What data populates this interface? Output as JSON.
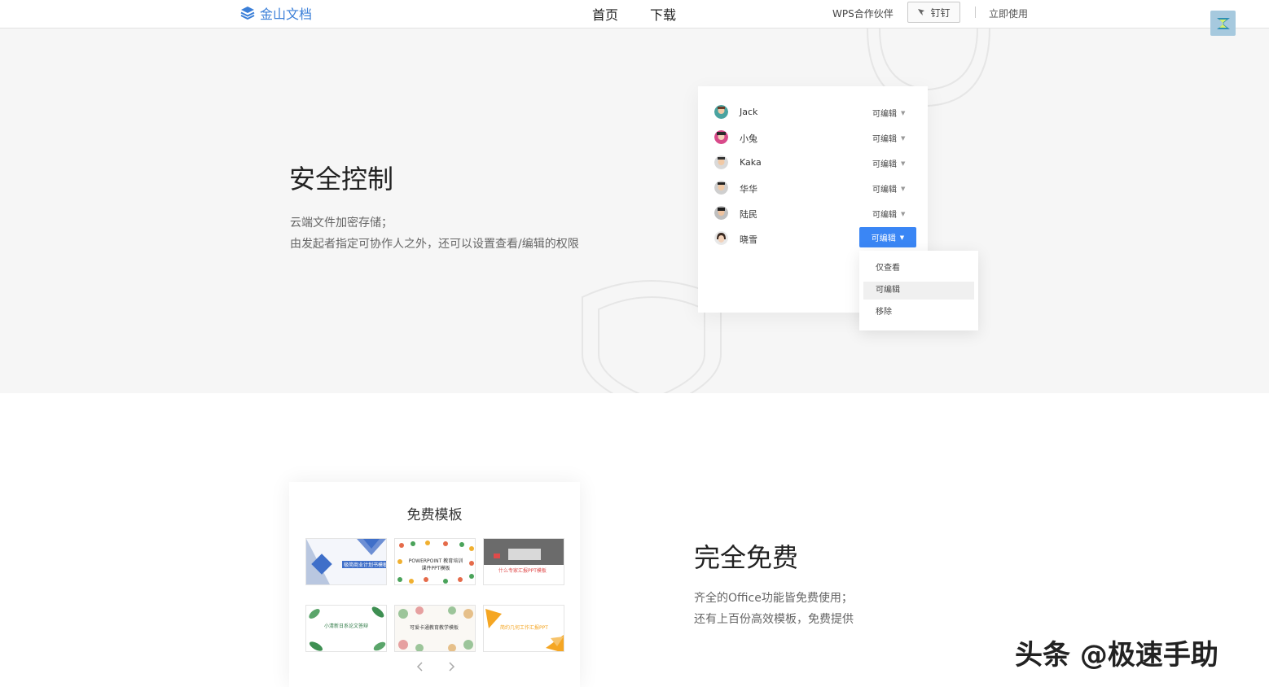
{
  "header": {
    "logo_text": "金山文档",
    "nav": [
      "首页",
      "下载"
    ],
    "partner": "WPS合作伙伴",
    "dingding": "钉钉",
    "use_now": "立即使用"
  },
  "security": {
    "title": "安全控制",
    "desc_lines": [
      "云端文件加密存储；",
      "由发起者指定可协作人之外，还可以设置查看/编辑的权限"
    ],
    "members": [
      {
        "name": "Jack",
        "permission": "可编辑"
      },
      {
        "name": "小兔",
        "permission": "可编辑"
      },
      {
        "name": "Kaka",
        "permission": "可编辑"
      },
      {
        "name": "华华",
        "permission": "可编辑"
      },
      {
        "name": "陆民",
        "permission": "可编辑"
      },
      {
        "name": "晓雪",
        "permission": "可编辑"
      }
    ],
    "menu": [
      "仅查看",
      "可编辑",
      "移除"
    ],
    "menu_selected": "可编辑"
  },
  "templates": {
    "title": "免费模板",
    "thumbs": [
      "极简商业计划书模板",
      "POWERPOINT 教育培训课件PPT模板",
      "什么专家汇报PPT模板",
      "小清新日系论文答辩",
      "可爱卡通教育教学模板",
      "简约几何工作汇报PPT"
    ]
  },
  "free": {
    "title": "完全免费",
    "desc_lines": [
      "齐全的Office功能皆免费使用；",
      "还有上百份高效模板，免费提供"
    ]
  },
  "watermark": "头条 @极速手助",
  "colors": {
    "accent": "#3a86f5",
    "logo": "#3b7fd8",
    "section_bg": "#f6f6f6"
  }
}
